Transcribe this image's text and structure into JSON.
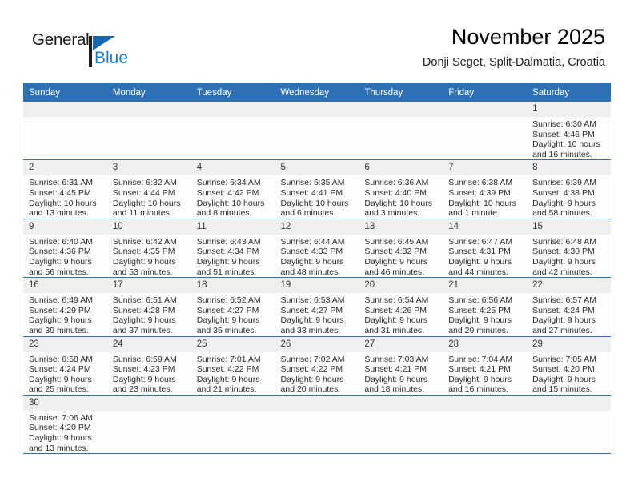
{
  "brand": {
    "name_top": "General",
    "name_bottom": "Blue",
    "accent_color": "#1567b2",
    "blue_text_color": "#1a7fd4"
  },
  "header": {
    "title": "November 2025",
    "subtitle": "Donji Seget, Split-Dalmatia, Croatia"
  },
  "calendar": {
    "header_bg": "#2e70b4",
    "daynum_bg": "#efefef",
    "weekday_headers": [
      "Sunday",
      "Monday",
      "Tuesday",
      "Wednesday",
      "Thursday",
      "Friday",
      "Saturday"
    ],
    "weeks": [
      [
        {
          "day": "",
          "lines": []
        },
        {
          "day": "",
          "lines": []
        },
        {
          "day": "",
          "lines": []
        },
        {
          "day": "",
          "lines": []
        },
        {
          "day": "",
          "lines": []
        },
        {
          "day": "",
          "lines": []
        },
        {
          "day": "1",
          "lines": [
            "Sunrise: 6:30 AM",
            "Sunset: 4:46 PM",
            "Daylight: 10 hours",
            "and 16 minutes."
          ]
        }
      ],
      [
        {
          "day": "2",
          "lines": [
            "Sunrise: 6:31 AM",
            "Sunset: 4:45 PM",
            "Daylight: 10 hours",
            "and 13 minutes."
          ]
        },
        {
          "day": "3",
          "lines": [
            "Sunrise: 6:32 AM",
            "Sunset: 4:44 PM",
            "Daylight: 10 hours",
            "and 11 minutes."
          ]
        },
        {
          "day": "4",
          "lines": [
            "Sunrise: 6:34 AM",
            "Sunset: 4:42 PM",
            "Daylight: 10 hours",
            "and 8 minutes."
          ]
        },
        {
          "day": "5",
          "lines": [
            "Sunrise: 6:35 AM",
            "Sunset: 4:41 PM",
            "Daylight: 10 hours",
            "and 6 minutes."
          ]
        },
        {
          "day": "6",
          "lines": [
            "Sunrise: 6:36 AM",
            "Sunset: 4:40 PM",
            "Daylight: 10 hours",
            "and 3 minutes."
          ]
        },
        {
          "day": "7",
          "lines": [
            "Sunrise: 6:38 AM",
            "Sunset: 4:39 PM",
            "Daylight: 10 hours",
            "and 1 minute."
          ]
        },
        {
          "day": "8",
          "lines": [
            "Sunrise: 6:39 AM",
            "Sunset: 4:38 PM",
            "Daylight: 9 hours",
            "and 58 minutes."
          ]
        }
      ],
      [
        {
          "day": "9",
          "lines": [
            "Sunrise: 6:40 AM",
            "Sunset: 4:36 PM",
            "Daylight: 9 hours",
            "and 56 minutes."
          ]
        },
        {
          "day": "10",
          "lines": [
            "Sunrise: 6:42 AM",
            "Sunset: 4:35 PM",
            "Daylight: 9 hours",
            "and 53 minutes."
          ]
        },
        {
          "day": "11",
          "lines": [
            "Sunrise: 6:43 AM",
            "Sunset: 4:34 PM",
            "Daylight: 9 hours",
            "and 51 minutes."
          ]
        },
        {
          "day": "12",
          "lines": [
            "Sunrise: 6:44 AM",
            "Sunset: 4:33 PM",
            "Daylight: 9 hours",
            "and 48 minutes."
          ]
        },
        {
          "day": "13",
          "lines": [
            "Sunrise: 6:45 AM",
            "Sunset: 4:32 PM",
            "Daylight: 9 hours",
            "and 46 minutes."
          ]
        },
        {
          "day": "14",
          "lines": [
            "Sunrise: 6:47 AM",
            "Sunset: 4:31 PM",
            "Daylight: 9 hours",
            "and 44 minutes."
          ]
        },
        {
          "day": "15",
          "lines": [
            "Sunrise: 6:48 AM",
            "Sunset: 4:30 PM",
            "Daylight: 9 hours",
            "and 42 minutes."
          ]
        }
      ],
      [
        {
          "day": "16",
          "lines": [
            "Sunrise: 6:49 AM",
            "Sunset: 4:29 PM",
            "Daylight: 9 hours",
            "and 39 minutes."
          ]
        },
        {
          "day": "17",
          "lines": [
            "Sunrise: 6:51 AM",
            "Sunset: 4:28 PM",
            "Daylight: 9 hours",
            "and 37 minutes."
          ]
        },
        {
          "day": "18",
          "lines": [
            "Sunrise: 6:52 AM",
            "Sunset: 4:27 PM",
            "Daylight: 9 hours",
            "and 35 minutes."
          ]
        },
        {
          "day": "19",
          "lines": [
            "Sunrise: 6:53 AM",
            "Sunset: 4:27 PM",
            "Daylight: 9 hours",
            "and 33 minutes."
          ]
        },
        {
          "day": "20",
          "lines": [
            "Sunrise: 6:54 AM",
            "Sunset: 4:26 PM",
            "Daylight: 9 hours",
            "and 31 minutes."
          ]
        },
        {
          "day": "21",
          "lines": [
            "Sunrise: 6:56 AM",
            "Sunset: 4:25 PM",
            "Daylight: 9 hours",
            "and 29 minutes."
          ]
        },
        {
          "day": "22",
          "lines": [
            "Sunrise: 6:57 AM",
            "Sunset: 4:24 PM",
            "Daylight: 9 hours",
            "and 27 minutes."
          ]
        }
      ],
      [
        {
          "day": "23",
          "lines": [
            "Sunrise: 6:58 AM",
            "Sunset: 4:24 PM",
            "Daylight: 9 hours",
            "and 25 minutes."
          ]
        },
        {
          "day": "24",
          "lines": [
            "Sunrise: 6:59 AM",
            "Sunset: 4:23 PM",
            "Daylight: 9 hours",
            "and 23 minutes."
          ]
        },
        {
          "day": "25",
          "lines": [
            "Sunrise: 7:01 AM",
            "Sunset: 4:22 PM",
            "Daylight: 9 hours",
            "and 21 minutes."
          ]
        },
        {
          "day": "26",
          "lines": [
            "Sunrise: 7:02 AM",
            "Sunset: 4:22 PM",
            "Daylight: 9 hours",
            "and 20 minutes."
          ]
        },
        {
          "day": "27",
          "lines": [
            "Sunrise: 7:03 AM",
            "Sunset: 4:21 PM",
            "Daylight: 9 hours",
            "and 18 minutes."
          ]
        },
        {
          "day": "28",
          "lines": [
            "Sunrise: 7:04 AM",
            "Sunset: 4:21 PM",
            "Daylight: 9 hours",
            "and 16 minutes."
          ]
        },
        {
          "day": "29",
          "lines": [
            "Sunrise: 7:05 AM",
            "Sunset: 4:20 PM",
            "Daylight: 9 hours",
            "and 15 minutes."
          ]
        }
      ],
      [
        {
          "day": "30",
          "lines": [
            "Sunrise: 7:06 AM",
            "Sunset: 4:20 PM",
            "Daylight: 9 hours",
            "and 13 minutes."
          ]
        },
        {
          "day": "",
          "lines": []
        },
        {
          "day": "",
          "lines": []
        },
        {
          "day": "",
          "lines": []
        },
        {
          "day": "",
          "lines": []
        },
        {
          "day": "",
          "lines": []
        },
        {
          "day": "",
          "lines": []
        }
      ]
    ]
  }
}
